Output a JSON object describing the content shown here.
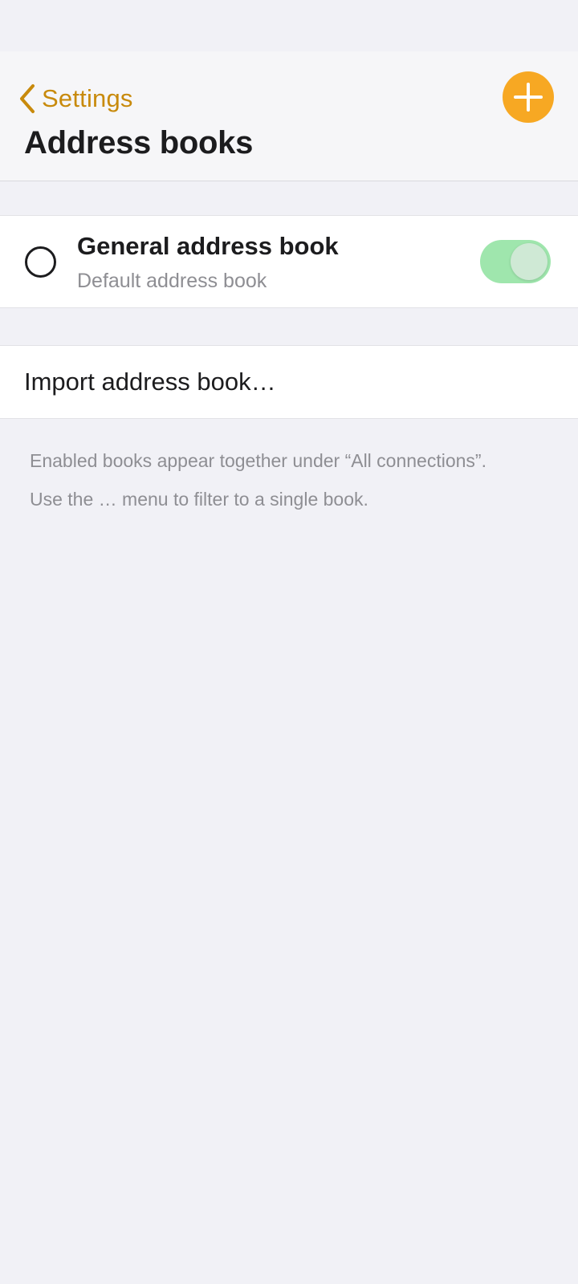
{
  "header": {
    "back_label": "Settings",
    "title": "Address books",
    "add_icon": "plus-icon",
    "back_icon": "chevron-left-icon"
  },
  "address_books": [
    {
      "name": "General address book",
      "subtitle": "Default address book",
      "selected": false,
      "enabled": true
    }
  ],
  "import": {
    "label": "Import address book…"
  },
  "footer": {
    "line1": "Enabled books appear together under “All connections”.",
    "line2": "Use the … menu to filter to a single book."
  },
  "colors": {
    "accent": "#f7a823",
    "back_text": "#c88a0c",
    "toggle_on": "#9fe6ad",
    "background": "#f1f1f6",
    "secondary_text": "#8e8e93"
  }
}
